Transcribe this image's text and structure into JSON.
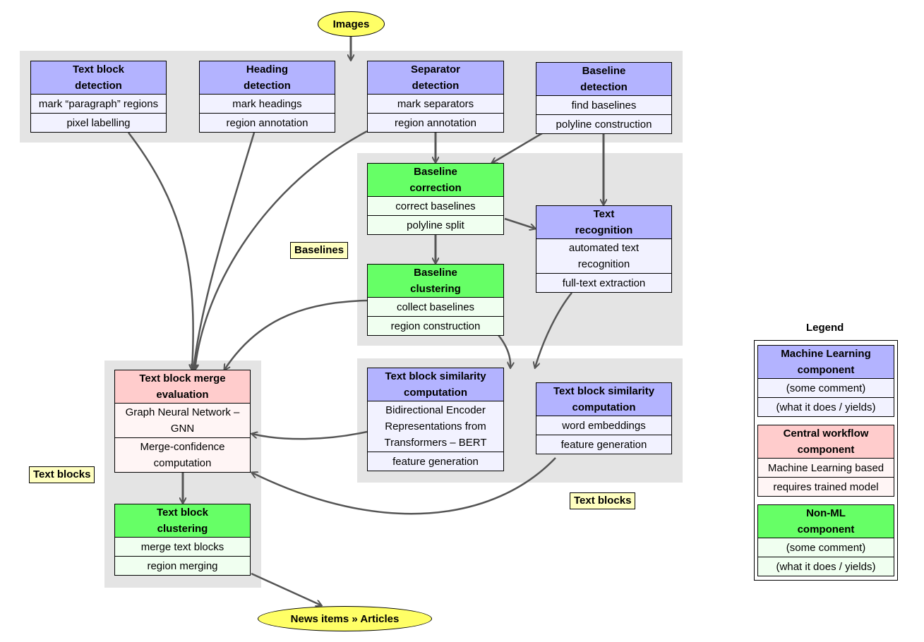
{
  "start": {
    "label": "Images"
  },
  "end": {
    "label": "News items » Articles"
  },
  "cluster_labels": {
    "baselines": "Baselines",
    "text_blocks_left": "Text blocks",
    "text_blocks_right": "Text blocks"
  },
  "nodes": {
    "text_block_detection": {
      "title": [
        "Text block",
        "detection"
      ],
      "rows": [
        "mark “paragraph” regions",
        "pixel labelling"
      ],
      "type": "ml"
    },
    "heading_detection": {
      "title": [
        "Heading",
        "detection"
      ],
      "rows": [
        "mark headings",
        "region annotation"
      ],
      "type": "ml"
    },
    "separator_detection": {
      "title": [
        "Separator",
        "detection"
      ],
      "rows": [
        "mark separators",
        "region annotation"
      ],
      "type": "ml"
    },
    "baseline_detection": {
      "title": [
        "Baseline",
        "detection"
      ],
      "rows": [
        "find baselines",
        "polyline construction"
      ],
      "type": "ml"
    },
    "baseline_correction": {
      "title": [
        "Baseline",
        "correction"
      ],
      "rows": [
        "correct baselines",
        "polyline split"
      ],
      "type": "nonml"
    },
    "text_recognition": {
      "title": [
        "Text",
        "recognition"
      ],
      "rows": [
        "automated text recognition",
        "full-text extraction"
      ],
      "type": "ml"
    },
    "baseline_clustering": {
      "title": [
        "Baseline",
        "clustering"
      ],
      "rows": [
        "collect baselines",
        "region construction"
      ],
      "type": "nonml"
    },
    "text_block_merge_evaluation": {
      "title": [
        "Text block merge",
        "evaluation"
      ],
      "rows": [
        "Graph Neural Network – GNN",
        "Merge-confidence computation"
      ],
      "type": "central"
    },
    "text_block_similarity_bert": {
      "title": [
        "Text block similarity",
        "computation"
      ],
      "rows": [
        "Bidirectional Encoder Representations from Transformers – BERT",
        "feature generation"
      ],
      "type": "ml"
    },
    "text_block_similarity_embeddings": {
      "title": [
        "Text block similarity",
        "computation"
      ],
      "rows": [
        "word embeddings",
        "feature generation"
      ],
      "type": "ml"
    },
    "text_block_clustering": {
      "title": [
        "Text block",
        "clustering"
      ],
      "rows": [
        "merge text blocks",
        "region merging"
      ],
      "type": "nonml"
    }
  },
  "legend": {
    "title": "Legend",
    "items": [
      {
        "title": [
          "Machine Learning",
          "component"
        ],
        "rows": [
          "(some comment)",
          "(what it does / yields)"
        ],
        "type": "ml"
      },
      {
        "title": [
          "Central workflow",
          "component"
        ],
        "rows": [
          "Machine Learning based",
          "requires trained model"
        ],
        "type": "central"
      },
      {
        "title": [
          "Non-ML",
          "component"
        ],
        "rows": [
          "(some comment)",
          "(what it does / yields)"
        ],
        "type": "nonml"
      }
    ]
  },
  "colors": {
    "ml_header": "#b3b3ff",
    "ml_body": "#f2f2ff",
    "nonml_header": "#66ff66",
    "nonml_body": "#f0fff0",
    "central_header": "#ffcccc",
    "central_body": "#fff5f5",
    "terminal": "#ffff66",
    "cluster": "#e4e4e4",
    "tag": "#ffffc0",
    "edge": "#555555"
  }
}
